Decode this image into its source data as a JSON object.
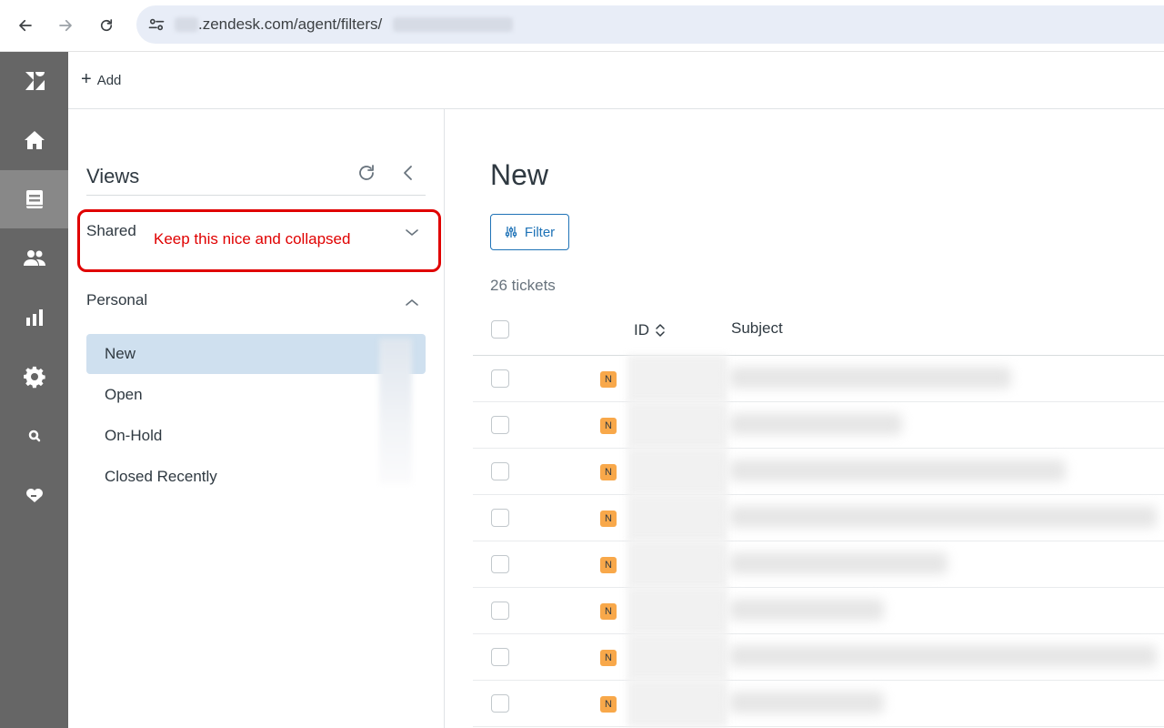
{
  "browser": {
    "url_text": ".zendesk.com/agent/filters/",
    "icons": [
      "back-arrow-icon",
      "forward-arrow-icon",
      "reload-icon",
      "site-settings-icon"
    ]
  },
  "nav_rail": {
    "items": [
      {
        "name": "zendesk-logo",
        "icon": "zendesk-logo-icon"
      },
      {
        "name": "home",
        "icon": "home-icon"
      },
      {
        "name": "views",
        "icon": "views-icon",
        "active": true
      },
      {
        "name": "customers",
        "icon": "customers-icon"
      },
      {
        "name": "reporting",
        "icon": "bar-chart-icon"
      },
      {
        "name": "admin",
        "icon": "gear-icon"
      },
      {
        "name": "search",
        "icon": "search-icon"
      },
      {
        "name": "apps",
        "icon": "heart-hand-icon"
      }
    ],
    "background": "#666666",
    "active_background": "#888888"
  },
  "app_bar": {
    "add_label": "Add"
  },
  "views_panel": {
    "title": "Views",
    "sections": {
      "shared": {
        "label": "Shared",
        "collapsed": true
      },
      "personal": {
        "label": "Personal",
        "collapsed": false
      }
    },
    "annotation": "Keep this nice and collapsed",
    "items": [
      {
        "label": "New",
        "selected": true
      },
      {
        "label": "Open"
      },
      {
        "label": "On-Hold"
      },
      {
        "label": "Closed Recently"
      }
    ]
  },
  "main": {
    "title": "New",
    "filter_label": "Filter",
    "ticket_count": "26 tickets",
    "columns": {
      "id": "ID",
      "subject": "Subject"
    },
    "rows": [
      {
        "status": "N",
        "subject_blur": 310
      },
      {
        "status": "N",
        "subject_blur": 190
      },
      {
        "status": "N",
        "subject_blur": 370
      },
      {
        "status": "N",
        "subject_blur": 470
      },
      {
        "status": "N",
        "subject_blur": 240
      },
      {
        "status": "N",
        "subject_blur": 170
      },
      {
        "status": "N",
        "subject_blur": 470
      },
      {
        "status": "N",
        "subject_blur": 170
      }
    ],
    "accent_color": "#1f73b7",
    "status_new_color": "#f8a84a"
  }
}
